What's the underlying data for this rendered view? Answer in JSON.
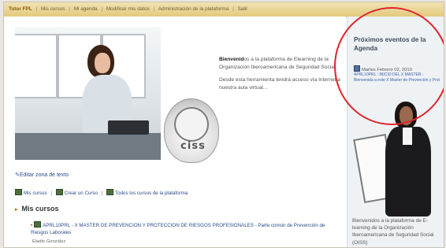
{
  "nav": {
    "user": "Tutor FPL",
    "sep": "|",
    "items": [
      "Mis cursos",
      "Mi agenda",
      "Modificar mis datos",
      "Administración de la plataforma",
      "Salir"
    ]
  },
  "hero": {
    "logo_text": "ciss"
  },
  "welcome": {
    "bold": "Bienvenid",
    "text_1_rest": "os a la plataforma de Elearning de la Organización Iberoamericana de Seguridad Social.",
    "text_2": "Desde esta herramienta tendrá acceso vía Internet a nuestra aula virtual..."
  },
  "edit_zone": {
    "label": "Editar zona de texto"
  },
  "quick_links": {
    "sep": "|",
    "items": [
      "Mis cursos",
      "Crear un Curso",
      "Todos los cursos de la plataforma"
    ]
  },
  "courses": {
    "heading": "Mis cursos",
    "item_text": "APRL10PRL - X MASTER DE PREVENCION Y PROTECCION DE RIESGOS PROFESIONALES - Parte común de Prevención de Riesgos Laborales",
    "teacher": "Eladio González"
  },
  "agenda": {
    "title": "Próximos eventos de la Agenda",
    "date": "Martes Febrero 02, 2010",
    "description": "APRL10PRL : INICIO DEL X MASTER - Bienvenida a este X Master de Prevención y Prot"
  },
  "side": {
    "welcome": "Bienvenidos a la plataforma de E-learning de la Organización Iberoamericana de Seguridad Social (OISS)"
  },
  "colors": {
    "topbar": "#e3c97b",
    "link": "#2b4b8b",
    "highlight": "#e0242b",
    "sidebar": "#eef2f5"
  }
}
